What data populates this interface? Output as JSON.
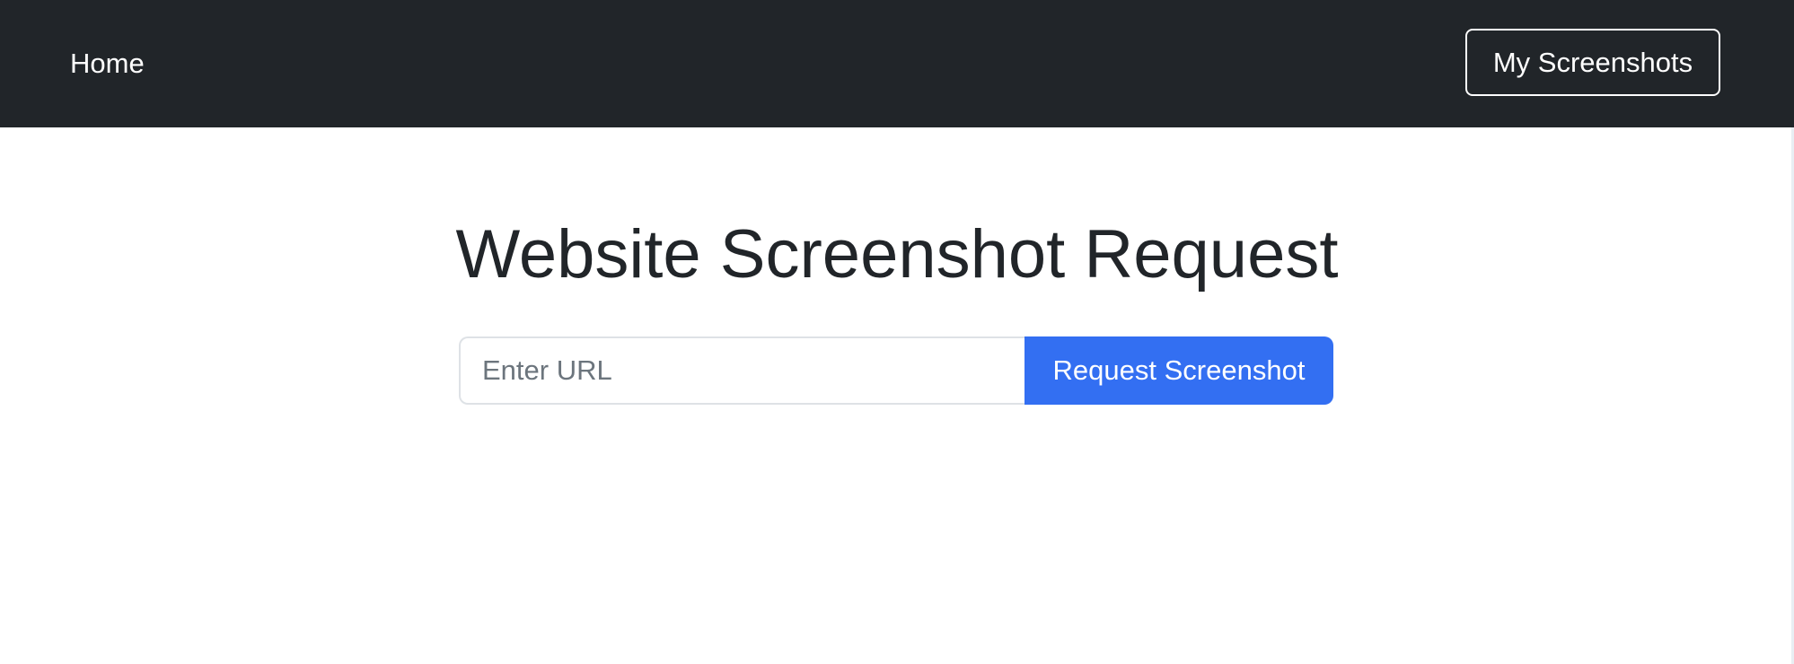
{
  "navbar": {
    "home_label": "Home",
    "my_screenshots_label": "My Screenshots"
  },
  "main": {
    "title": "Website Screenshot Request",
    "url_input": {
      "value": "",
      "placeholder": "Enter URL"
    },
    "request_button_label": "Request Screenshot"
  },
  "colors": {
    "navbar_background": "#212529",
    "primary_button": "#336ff2",
    "title_text": "#212529",
    "placeholder_text": "#6c757d"
  }
}
